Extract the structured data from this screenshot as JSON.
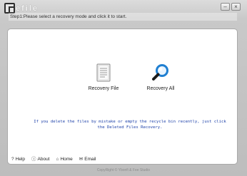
{
  "app": {
    "logo_text": "efile"
  },
  "window": {
    "minimize_glyph": "–",
    "close_glyph": "×"
  },
  "step": {
    "text": "Step1:Please select a recovery mode and click it to start."
  },
  "actions": {
    "recovery_file": {
      "label": "Recovery File",
      "icon": "document-icon"
    },
    "recovery_all": {
      "label": "Recovery All",
      "icon": "magnifier-icon"
    }
  },
  "hint": "If you delete the files by mistake or empty the recycle bin recently, just click the Deleted Files Recovery.",
  "footer": {
    "links": [
      {
        "label": "Help",
        "icon": "question-icon",
        "glyph": "?"
      },
      {
        "label": "About",
        "icon": "info-icon",
        "glyph": "ⓘ"
      },
      {
        "label": "Home",
        "icon": "home-icon",
        "glyph": "⌂"
      },
      {
        "label": "Email",
        "icon": "mail-icon",
        "glyph": "✉"
      }
    ],
    "copyright": "CopyRight © Ybonfi & Fee Studio"
  },
  "colors": {
    "hint_text": "#1b3fa8",
    "magnifier": "#1f7fd1"
  }
}
